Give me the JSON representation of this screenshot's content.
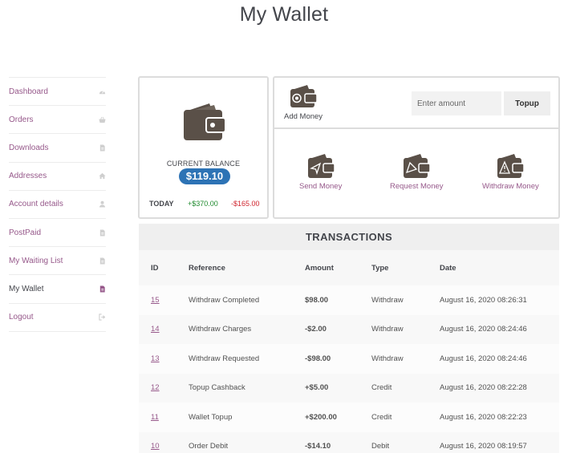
{
  "page": {
    "title": "My Wallet"
  },
  "colors": {
    "accent": "#96588a",
    "balance_badge": "#2d73b5",
    "credit": "#1f8a2e",
    "debit": "#d0262f",
    "wallet_icon": "#5a5048"
  },
  "sidebar": {
    "items": [
      {
        "label": "Dashboard",
        "icon": "gauge-icon"
      },
      {
        "label": "Orders",
        "icon": "basket-icon"
      },
      {
        "label": "Downloads",
        "icon": "file-icon"
      },
      {
        "label": "Addresses",
        "icon": "home-icon"
      },
      {
        "label": "Account details",
        "icon": "user-icon"
      },
      {
        "label": "PostPaid",
        "icon": "file-icon"
      },
      {
        "label": "My Waiting List",
        "icon": "file-icon"
      },
      {
        "label": "My Wallet",
        "icon": "file-icon",
        "active": true
      },
      {
        "label": "Logout",
        "icon": "sign-out-icon"
      }
    ]
  },
  "balance": {
    "label": "CURRENT BALANCE",
    "amount": "$119.10",
    "today_label": "TODAY",
    "today_credit": "+$370.00",
    "today_debit": "-$165.00"
  },
  "actions": {
    "add_money": "Add Money",
    "amount_placeholder": "Enter amount",
    "topup": "Topup",
    "send_money": "Send Money",
    "request_money": "Request Money",
    "withdraw_money": "Withdraw Money"
  },
  "transactions": {
    "title": "TRANSACTIONS",
    "columns": [
      "ID",
      "Reference",
      "Amount",
      "Type",
      "Date"
    ],
    "rows": [
      {
        "id": "15",
        "reference": "Withdraw Completed",
        "amount": "$98.00",
        "type": "Withdraw",
        "date": "August 16, 2020 08:26:31"
      },
      {
        "id": "14",
        "reference": "Withdraw Charges",
        "amount": "-$2.00",
        "type": "Withdraw",
        "date": "August 16, 2020 08:24:46"
      },
      {
        "id": "13",
        "reference": "Withdraw Requested",
        "amount": "-$98.00",
        "type": "Withdraw",
        "date": "August 16, 2020 08:24:46"
      },
      {
        "id": "12",
        "reference": "Topup Cashback",
        "amount": "+$5.00",
        "type": "Credit",
        "date": "August 16, 2020 08:22:28"
      },
      {
        "id": "11",
        "reference": "Wallet Topup",
        "amount": "+$200.00",
        "type": "Credit",
        "date": "August 16, 2020 08:22:23"
      },
      {
        "id": "10",
        "reference": "Order Debit",
        "amount": "-$14.10",
        "type": "Debit",
        "date": "August 16, 2020 08:19:57"
      }
    ]
  }
}
